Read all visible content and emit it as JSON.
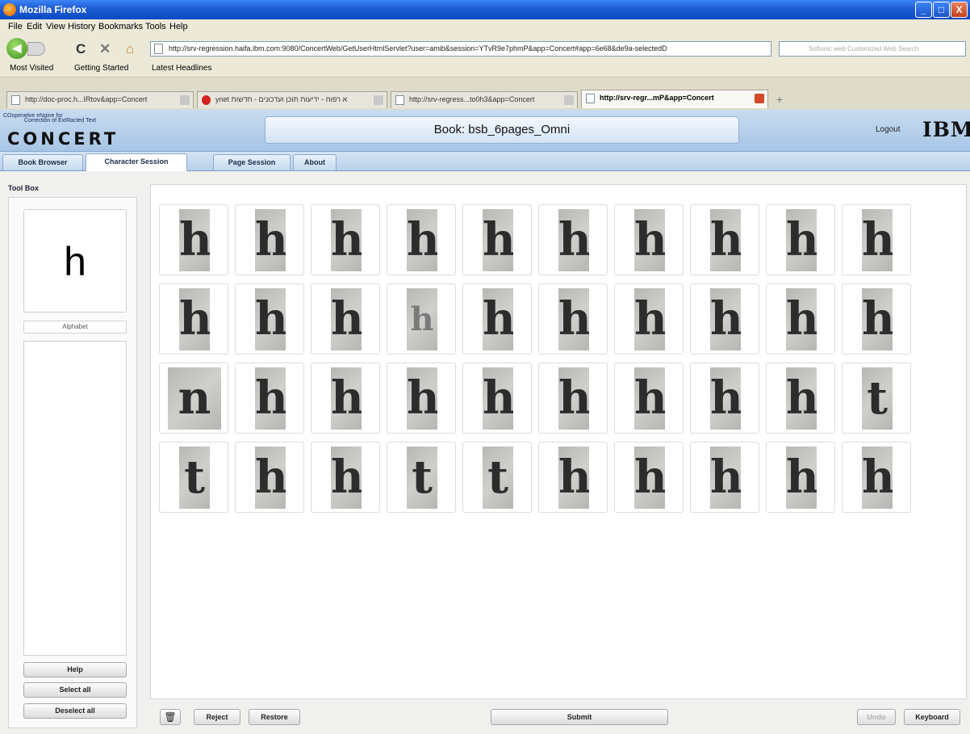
{
  "window": {
    "title": "Mozilla Firefox",
    "minimize": "_",
    "maximize": "□",
    "close": "X"
  },
  "menu": [
    "File",
    "Edit",
    "View",
    "History",
    "Bookmarks",
    "Tools",
    "Help"
  ],
  "nav": {
    "back": "◀",
    "reload": "C",
    "stop": "✕",
    "home": "⌂",
    "url": "http://srv-regression.haifa.ibm.com:9080/ConcertWeb/GetUserHtmlServlet?user=amib&session=YTvR9e7phmP&app=Concert#app=6e68&de9a-selectedD",
    "search_placeholder": "Softonic web Customized Web Search"
  },
  "bookmarks": [
    "Most Visited",
    "Getting Started",
    "Latest Headlines"
  ],
  "tabs": [
    {
      "label": "http://doc-proc.h...IRtov&app=Concert",
      "active": false
    },
    {
      "label": "ynet א רפוח - ידיעות תוכן ועדכונים - חדשות",
      "active": false
    },
    {
      "label": "http://srv-regress...to0h3&app=Concert",
      "active": false
    },
    {
      "label": "http://srv-regr...mP&app=Concert",
      "active": true
    }
  ],
  "new_tab": "+",
  "app": {
    "logo_sub1": "COoperative eNgine for",
    "logo_sub2": "Correction of ExtRacted Text",
    "logo": "CONCERT",
    "book_title": "Book: bsb_6pages_Omni",
    "logout": "Logout",
    "brand": "IBM",
    "tabs": [
      "Book Browser",
      "Character Session",
      "Page Session",
      "About"
    ],
    "active_tab": "Character Session"
  },
  "toolbox": {
    "label": "Tool Box",
    "character": "h",
    "alphabet_label": "Alphabet",
    "help": "Help",
    "select_all": "Select all",
    "deselect_all": "Deselect all"
  },
  "glyphs": [
    [
      "h",
      "h",
      "h",
      "h",
      "h",
      "h",
      "h",
      "h",
      "h",
      "h"
    ],
    [
      "h",
      "h",
      "h",
      "h",
      "h",
      "h",
      "h",
      "h",
      "h",
      "h"
    ],
    [
      "n",
      "h",
      "h",
      "h",
      "h",
      "h",
      "h",
      "h",
      "h",
      "t"
    ],
    [
      "t",
      "h",
      "h",
      "t",
      "t",
      "h",
      "h",
      "h",
      "h",
      "h"
    ]
  ],
  "bottom": {
    "trash_icon": "🗑",
    "reject": "Reject",
    "restore": "Restore",
    "submit": "Submit",
    "undo": "Undo",
    "keyboard": "Keyboard"
  }
}
